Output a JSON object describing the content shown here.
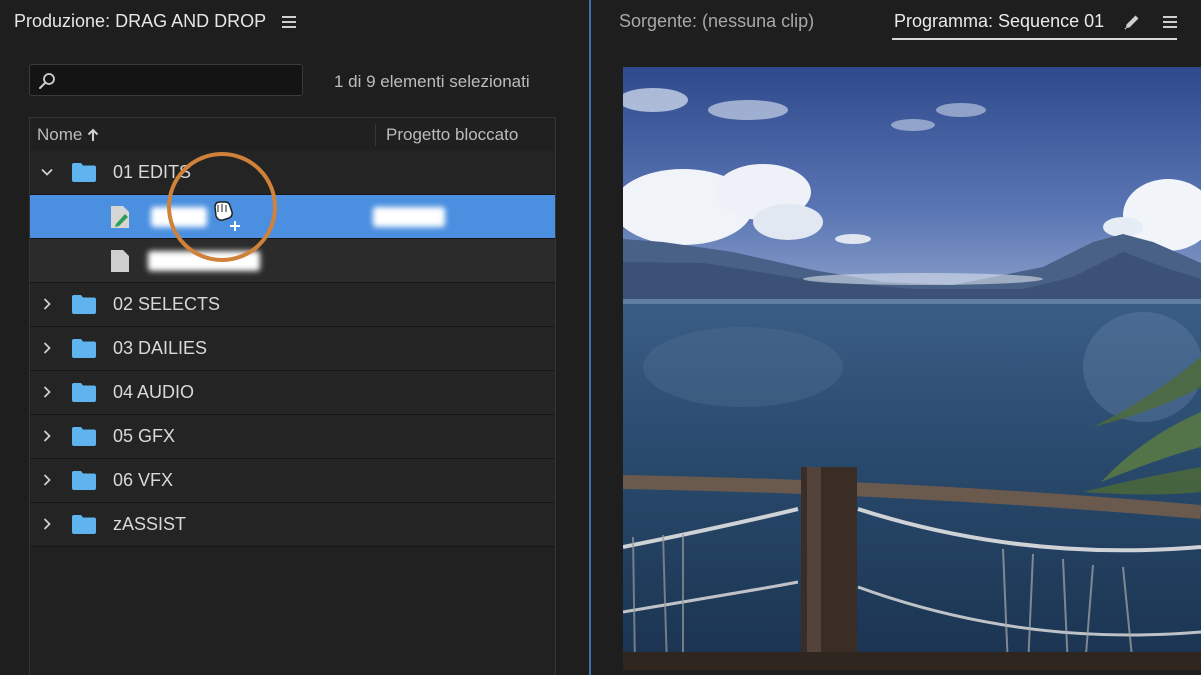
{
  "project_panel": {
    "title": "Produzione: DRAG AND DROP",
    "search": {
      "value": "",
      "placeholder": ""
    },
    "selection_count": "1 di 9 elementi selezionati",
    "columns": {
      "name": "Nome",
      "locked": "Progetto bloccato"
    },
    "items": [
      {
        "label": "01 EDITS",
        "type": "folder",
        "expanded": true
      },
      {
        "label": "",
        "type": "sequence",
        "selected": true,
        "blurred": true
      },
      {
        "label": "",
        "type": "file",
        "blurred": true
      },
      {
        "label": "02 SELECTS",
        "type": "folder"
      },
      {
        "label": "03 DAILIES",
        "type": "folder"
      },
      {
        "label": "04 AUDIO",
        "type": "folder"
      },
      {
        "label": "05 GFX",
        "type": "folder"
      },
      {
        "label": "06 VFX",
        "type": "folder"
      },
      {
        "label": "zASSIST",
        "type": "folder"
      }
    ]
  },
  "monitor": {
    "source_tab": "Sorgente: (nessuna clip)",
    "program_tab": "Programma: Sequence 01"
  },
  "icons": {
    "menu": "hamburger-menu-icon",
    "search": "search-icon",
    "sort": "sort-up-arrow-icon",
    "folder": "folder-icon",
    "chevron_right": "chevron-right-icon",
    "chevron_down": "chevron-down-icon",
    "sequence": "sequence-icon",
    "file": "file-icon",
    "pencil": "pencil-icon",
    "drag": "drag-hand-cursor-icon"
  },
  "colors": {
    "selection": "#4a8fe0",
    "folder": "#5fb4f0",
    "highlight_ring": "#d0813a",
    "panel_divider": "#3f6fb0"
  }
}
